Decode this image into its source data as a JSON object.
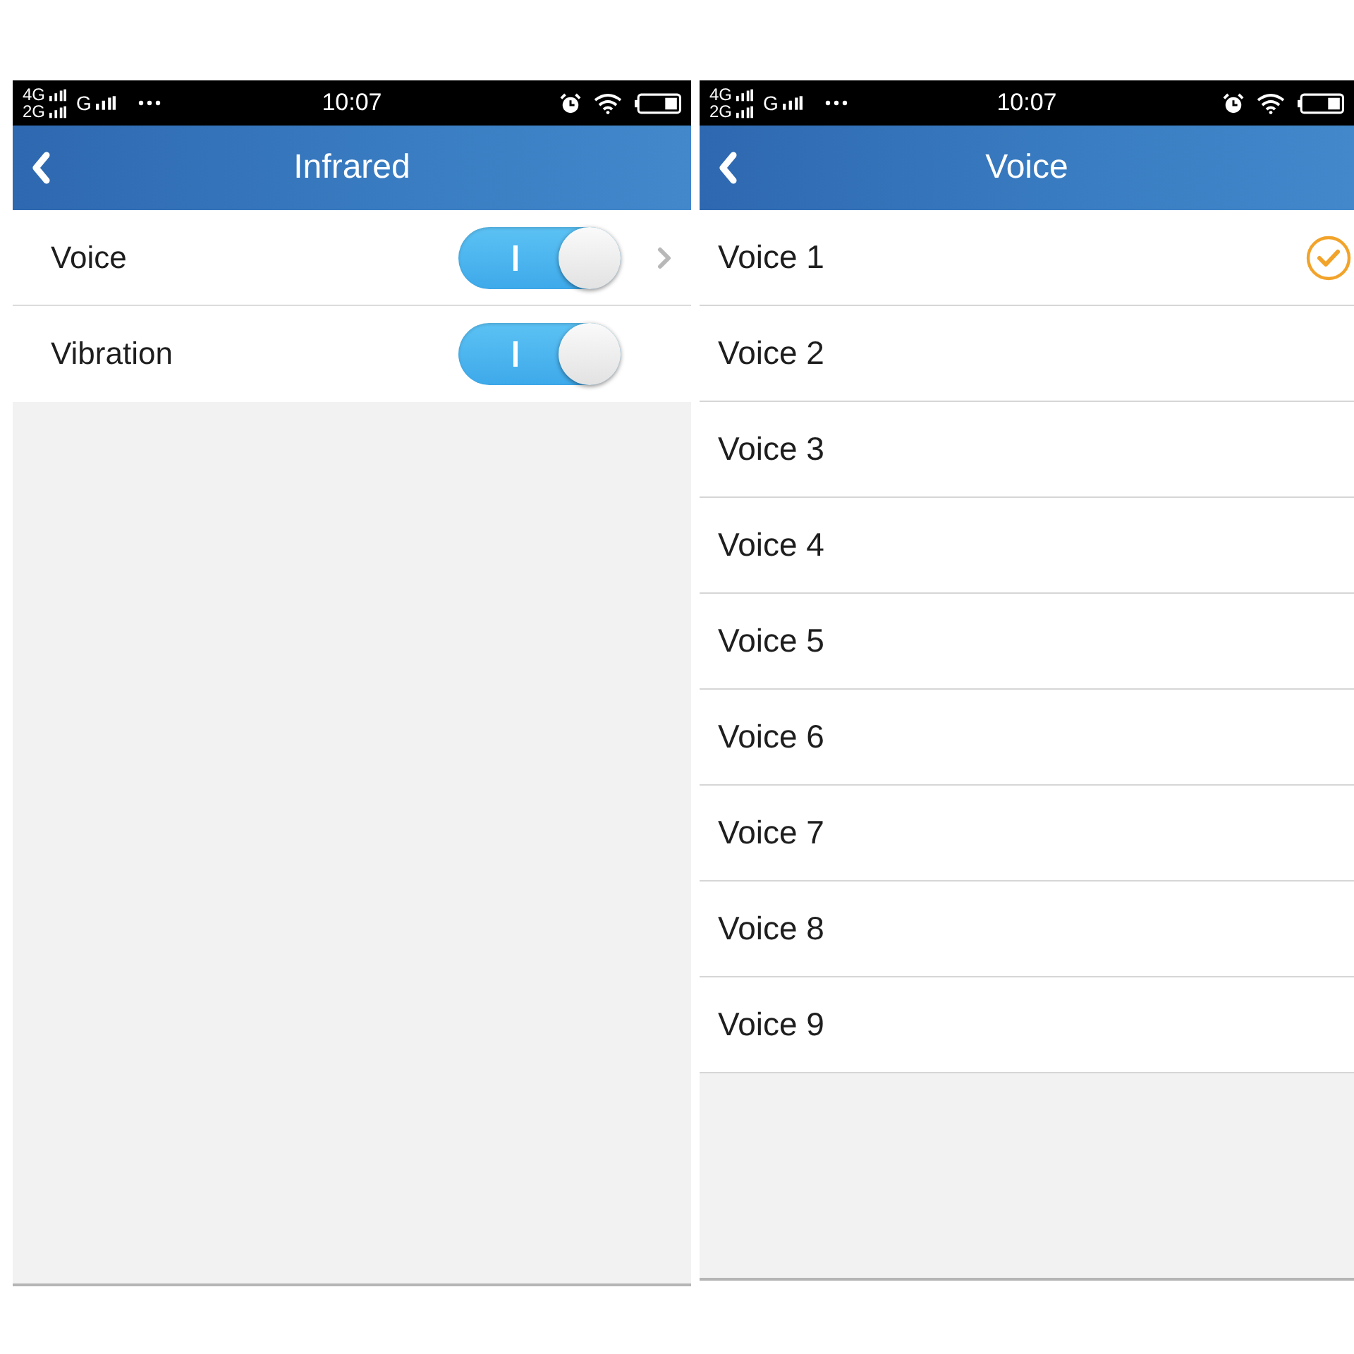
{
  "screens": [
    {
      "kind": "settings",
      "status_bar": {
        "sim_1": "4G",
        "sim_2": "2G",
        "sim_3": "G",
        "time": "10:07"
      },
      "header": {
        "title": "Infrared"
      },
      "rows": [
        {
          "kind": "toggle_link",
          "label": "Voice",
          "on": true
        },
        {
          "kind": "toggle",
          "label": "Vibration",
          "on": true
        }
      ]
    },
    {
      "kind": "choice",
      "status_bar": {
        "sim_1": "4G",
        "sim_2": "2G",
        "sim_3": "G",
        "time": "10:07"
      },
      "header": {
        "title": "Voice"
      },
      "options": [
        {
          "label": "Voice 1",
          "selected": true
        },
        {
          "label": "Voice 2",
          "selected": false
        },
        {
          "label": "Voice 3",
          "selected": false
        },
        {
          "label": "Voice 4",
          "selected": false
        },
        {
          "label": "Voice 5",
          "selected": false
        },
        {
          "label": "Voice 6",
          "selected": false
        },
        {
          "label": "Voice 7",
          "selected": false
        },
        {
          "label": "Voice 8",
          "selected": false
        },
        {
          "label": "Voice 9",
          "selected": false
        }
      ]
    }
  ]
}
